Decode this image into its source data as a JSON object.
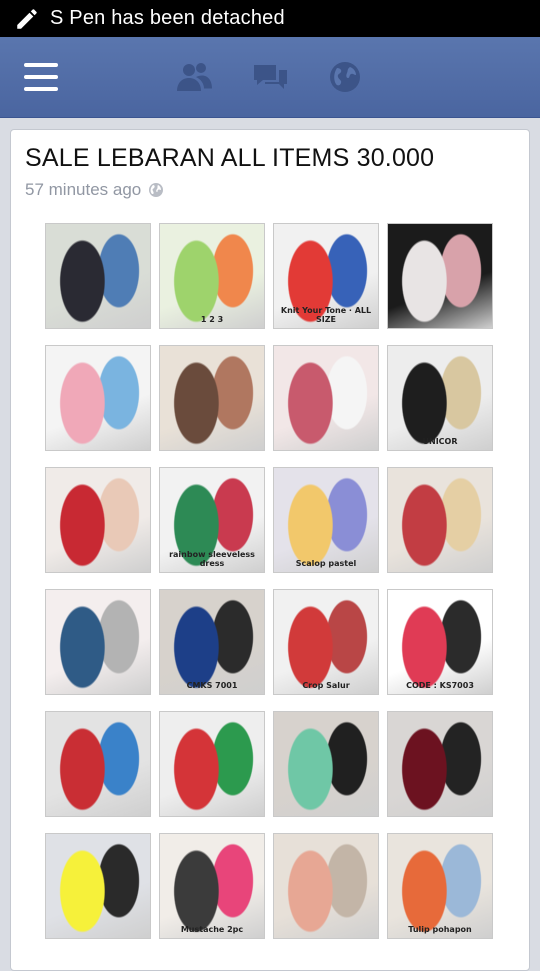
{
  "status_bar": {
    "icon": "pen-icon",
    "message": "S Pen has been detached"
  },
  "nav": {
    "icons": [
      "menu-icon",
      "friends-icon",
      "messages-icon",
      "globe-icon"
    ],
    "color": "#4f6aa5"
  },
  "post": {
    "title": "SALE LEBARAN ALL ITEMS 30.000",
    "time": "57 minutes ago",
    "privacy_icon": "globe-icon"
  },
  "photos": [
    {
      "caption": "",
      "colors": [
        "#d9ddd6",
        "#2a2a33",
        "#4f7db5"
      ]
    },
    {
      "caption": "1 2 3",
      "colors": [
        "#eaf1e0",
        "#9ed36c",
        "#f0874c"
      ]
    },
    {
      "caption": "Knit Your Tone · ALL SIZE",
      "colors": [
        "#f1f1f1",
        "#e23a36",
        "#3762b8"
      ]
    },
    {
      "caption": "",
      "colors": [
        "#1b1b1b",
        "#e8e4e4",
        "#d8a2aa"
      ]
    },
    {
      "caption": "",
      "colors": [
        "#f4f4f4",
        "#f0a8b8",
        "#7ab4e0"
      ]
    },
    {
      "caption": "",
      "colors": [
        "#e9e1d7",
        "#6a4b3c",
        "#b07760"
      ]
    },
    {
      "caption": "",
      "colors": [
        "#f2e7e7",
        "#c85a6d",
        "#f5f5f5"
      ]
    },
    {
      "caption": "UNICOR",
      "colors": [
        "#ededed",
        "#1e1e1e",
        "#d8c7a0"
      ]
    },
    {
      "caption": "",
      "colors": [
        "#f0ebe8",
        "#c82933",
        "#e9c9b7"
      ]
    },
    {
      "caption": "rainbow sleeveless dress",
      "colors": [
        "#f2f2f2",
        "#2d8a55",
        "#c93a4f"
      ]
    },
    {
      "caption": "Scalop pastel",
      "colors": [
        "#e4e2ea",
        "#f2c86b",
        "#8a8ed6"
      ]
    },
    {
      "caption": "",
      "colors": [
        "#e9e3dc",
        "#c23d43",
        "#e5cfa4"
      ]
    },
    {
      "caption": "",
      "colors": [
        "#f4eeee",
        "#2f5b86",
        "#b3b3b3"
      ]
    },
    {
      "caption": "CMKS 7001",
      "colors": [
        "#d7d2cc",
        "#1d3f88",
        "#2b2b2b"
      ]
    },
    {
      "caption": "Crop Salur",
      "colors": [
        "#f1f1f1",
        "#d13a3a",
        "#b94646"
      ]
    },
    {
      "caption": "CODE : KS7003",
      "colors": [
        "#ffffff",
        "#e03b55",
        "#2b2b2b"
      ]
    },
    {
      "caption": "",
      "colors": [
        "#e3e3e3",
        "#c92e34",
        "#3a82c9"
      ]
    },
    {
      "caption": "",
      "colors": [
        "#eeeeee",
        "#d43438",
        "#2c9a4e"
      ]
    },
    {
      "caption": "",
      "colors": [
        "#d7d2cd",
        "#6fc7a6",
        "#202020"
      ]
    },
    {
      "caption": "",
      "colors": [
        "#d9d6d4",
        "#6c1220",
        "#232323"
      ]
    },
    {
      "caption": "",
      "colors": [
        "#dfe1e6",
        "#f6f13a",
        "#2a2a2a"
      ]
    },
    {
      "caption": "Mustache 2pc",
      "colors": [
        "#f1ede8",
        "#3b3b3b",
        "#e8457a"
      ]
    },
    {
      "caption": "",
      "colors": [
        "#e7e0d8",
        "#e7a794",
        "#c3b5a7"
      ]
    },
    {
      "caption": "Tulip pohapon",
      "colors": [
        "#e9e4dd",
        "#e76a3a",
        "#9bb8d8"
      ]
    }
  ]
}
